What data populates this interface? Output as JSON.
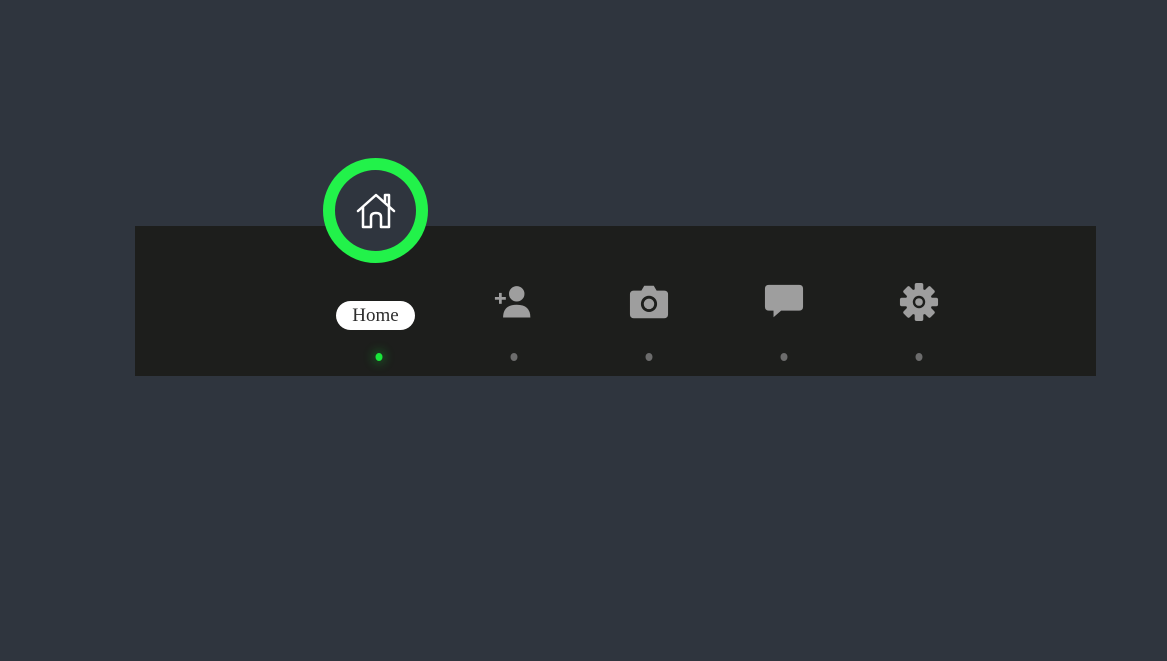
{
  "nav": {
    "active_index": 0,
    "active_color": "#22f24a",
    "items": [
      {
        "label": "Home",
        "icon": "home-icon"
      },
      {
        "label": "",
        "icon": "add-user-icon"
      },
      {
        "label": "",
        "icon": "camera-icon"
      },
      {
        "label": "",
        "icon": "chat-icon"
      },
      {
        "label": "",
        "icon": "gear-icon"
      }
    ]
  }
}
